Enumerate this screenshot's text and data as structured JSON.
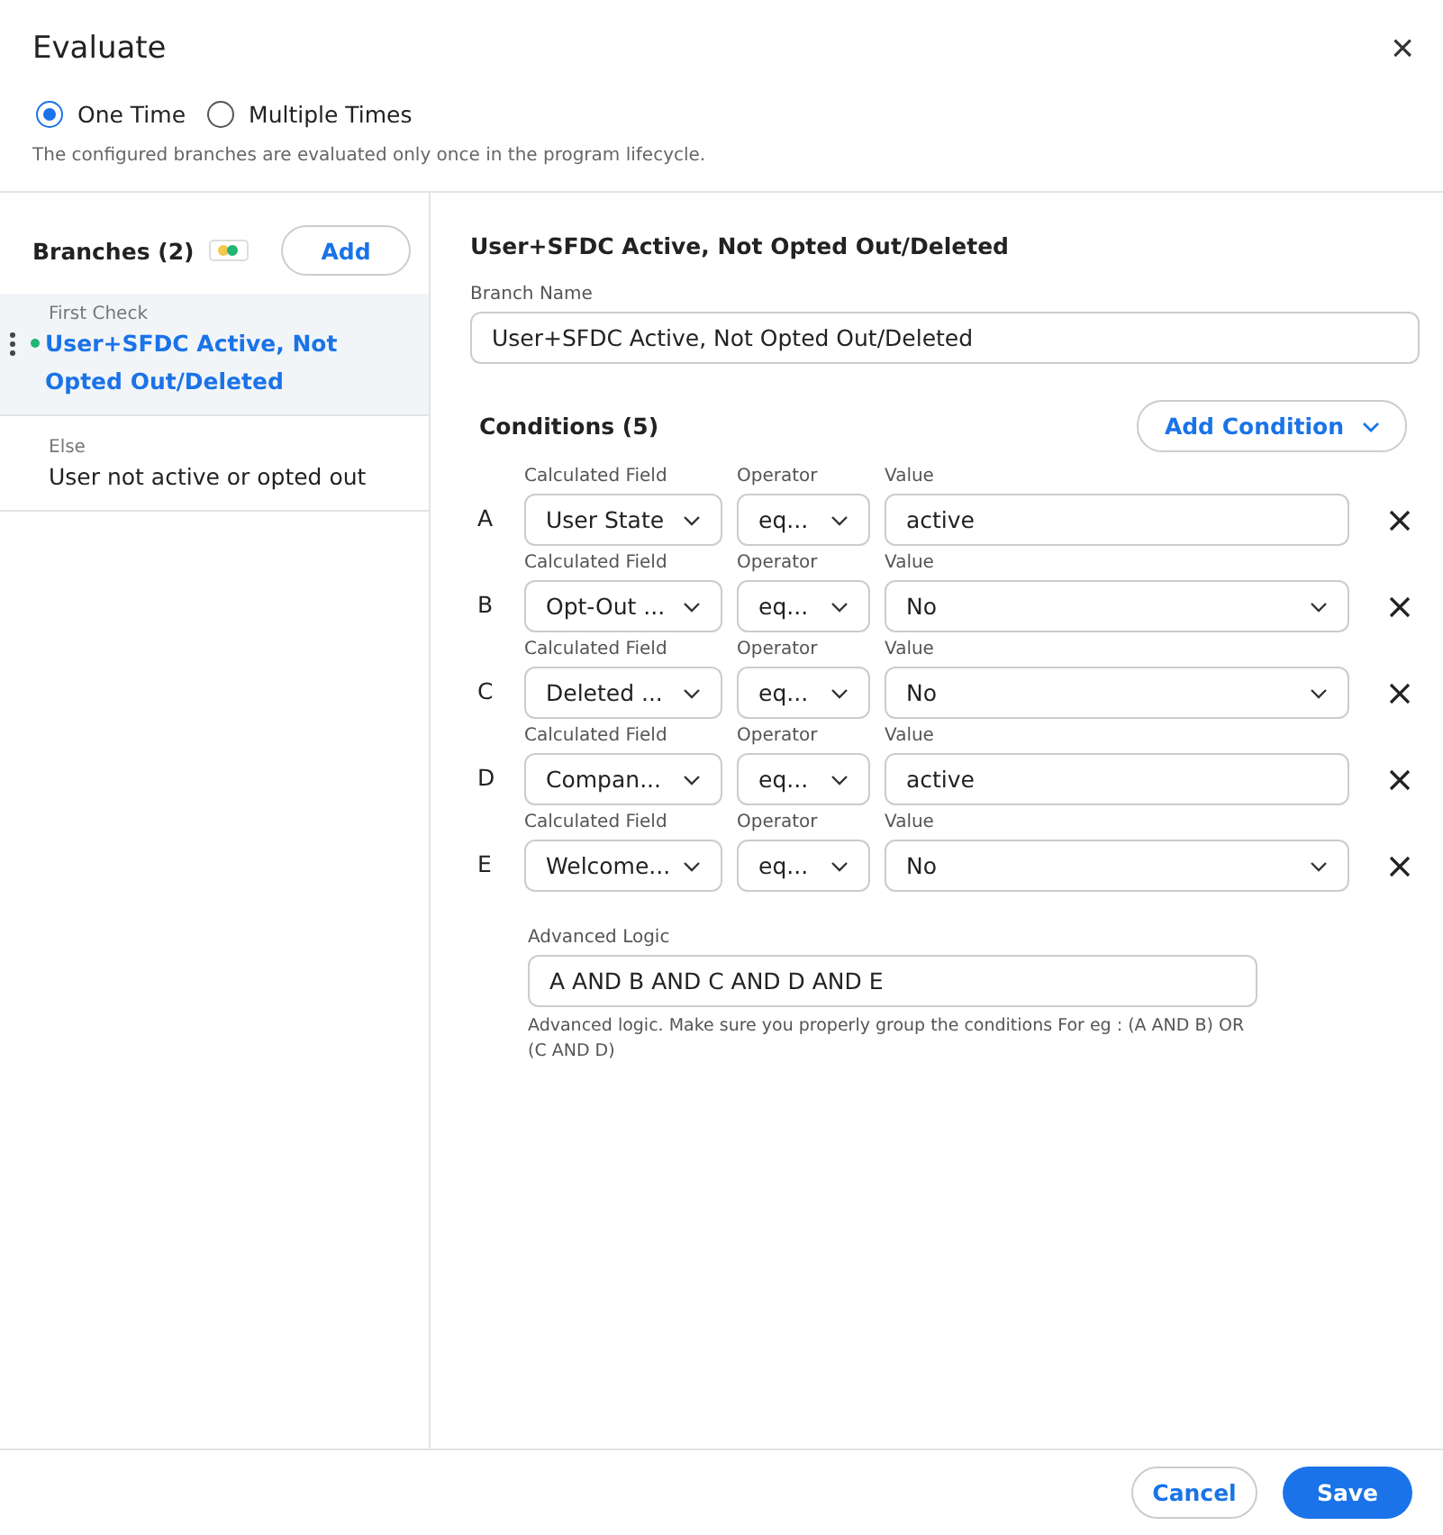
{
  "dialog": {
    "title": "Evaluate",
    "close": "×"
  },
  "frequency": {
    "options": [
      {
        "label": "One Time",
        "selected": true
      },
      {
        "label": "Multiple Times",
        "selected": false
      }
    ],
    "hint": "The configured branches are evaluated only once in the program lifecycle."
  },
  "branches": {
    "title": "Branches (2)",
    "add_button": "Add",
    "items": [
      {
        "caption": "First Check",
        "name": "User+SFDC Active, Not Opted Out/Deleted",
        "selected": true,
        "color": "#22b573"
      },
      {
        "caption": "Else",
        "name": "User not active or opted out",
        "selected": false
      }
    ]
  },
  "editor": {
    "heading": "User+SFDC Active, Not Opted Out/Deleted",
    "branch_name_label": "Branch Name",
    "branch_name": "User+SFDC Active, Not Opted Out/Deleted",
    "conditions_title": "Conditions (5)",
    "add_condition": "Add Condition",
    "conditions": [
      {
        "letter": "A",
        "field_label": "Calculated Field",
        "field": "User State",
        "operator_label": "Operator",
        "operator": "eq...",
        "value_label": "Value",
        "kind": "text",
        "value": "active"
      },
      {
        "letter": "B",
        "field_label": "Calculated Field",
        "field": "Opt-Out ...",
        "operator_label": "Operator",
        "operator": "eq...",
        "value_label": "Value",
        "kind": "select",
        "value": "No"
      },
      {
        "letter": "C",
        "field_label": "Calculated Field",
        "field": "Deleted ...",
        "operator_label": "Operator",
        "operator": "eq...",
        "value_label": "Value",
        "kind": "select",
        "value": "No"
      },
      {
        "letter": "D",
        "field_label": "Calculated Field",
        "field": "Compan...",
        "operator_label": "Operator",
        "operator": "eq...",
        "value_label": "Value",
        "kind": "text",
        "value": "active"
      },
      {
        "letter": "E",
        "field_label": "Calculated Field",
        "field": "Welcome...",
        "operator_label": "Operator",
        "operator": "eq...",
        "value_label": "Value",
        "kind": "select",
        "value": "No"
      }
    ],
    "advanced_label": "Advanced Logic",
    "advanced_value": "A AND B AND C AND D AND E",
    "advanced_hint": "Advanced logic. Make sure you properly group the conditions For eg : (A AND B) OR (C AND D)"
  },
  "footer": {
    "cancel": "Cancel",
    "save": "Save"
  }
}
